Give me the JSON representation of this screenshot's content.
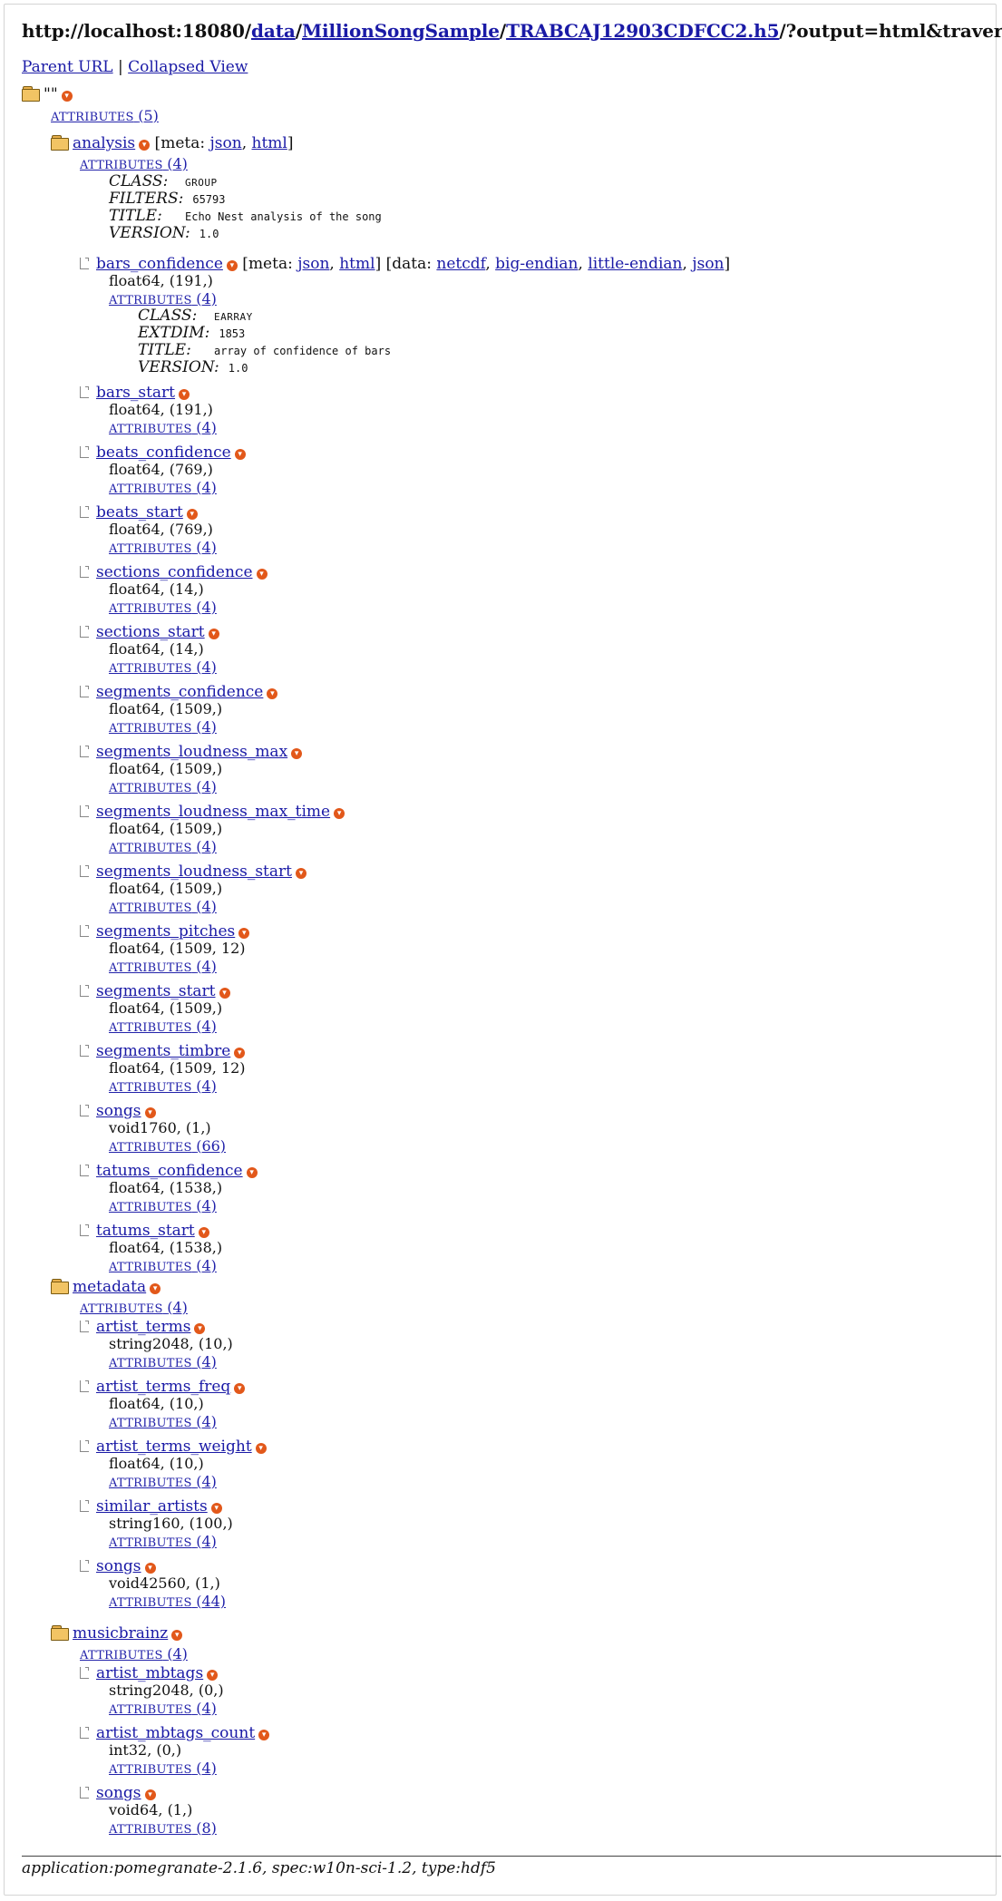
{
  "url": {
    "prefix": "http://localhost:18080/",
    "parts": [
      "data",
      "MillionSongSample",
      "TRABCAJ12903CDFCC2.h5"
    ],
    "suffix": "/?output=html&traverse"
  },
  "nav": {
    "parent": "Parent URL",
    "sep": "|",
    "collapsed": "Collapsed View"
  },
  "root": {
    "name": "\"\"",
    "attrs_label": "ATTRIBUTES",
    "attrs_count": "(5)"
  },
  "labels": {
    "meta": "meta",
    "data": "data",
    "attrs": "ATTRIBUTES",
    "expand_glyph": "▾"
  },
  "meta_links": [
    "json",
    "html"
  ],
  "data_links": [
    "netcdf",
    "big-endian",
    "little-endian",
    "json"
  ],
  "groups": [
    {
      "name": "analysis",
      "attrs_count": "(4)",
      "attributes": [
        {
          "key": "CLASS:",
          "val": "GROUP",
          "sc": true
        },
        {
          "key": "FILTERS:",
          "val": "65793"
        },
        {
          "key": "TITLE:",
          "val": "Echo Nest analysis of the song"
        },
        {
          "key": "VERSION:",
          "val": "1.0"
        }
      ],
      "datasets": [
        {
          "name": "bars_confidence",
          "dtype": "float64, (191,)",
          "attrs_count": "(4)",
          "expanded": true,
          "attributes": [
            {
              "key": "CLASS:",
              "val": "EARRAY",
              "sc": true
            },
            {
              "key": "EXTDIM:",
              "val": "1853"
            },
            {
              "key": "TITLE:",
              "val": "array of confidence of bars"
            },
            {
              "key": "VERSION:",
              "val": "1.0"
            }
          ]
        },
        {
          "name": "bars_start",
          "dtype": "float64, (191,)",
          "attrs_count": "(4)"
        },
        {
          "name": "beats_confidence",
          "dtype": "float64, (769,)",
          "attrs_count": "(4)"
        },
        {
          "name": "beats_start",
          "dtype": "float64, (769,)",
          "attrs_count": "(4)"
        },
        {
          "name": "sections_confidence",
          "dtype": "float64, (14,)",
          "attrs_count": "(4)"
        },
        {
          "name": "sections_start",
          "dtype": "float64, (14,)",
          "attrs_count": "(4)"
        },
        {
          "name": "segments_confidence",
          "dtype": "float64, (1509,)",
          "attrs_count": "(4)"
        },
        {
          "name": "segments_loudness_max",
          "dtype": "float64, (1509,)",
          "attrs_count": "(4)"
        },
        {
          "name": "segments_loudness_max_time",
          "dtype": "float64, (1509,)",
          "attrs_count": "(4)"
        },
        {
          "name": "segments_loudness_start",
          "dtype": "float64, (1509,)",
          "attrs_count": "(4)"
        },
        {
          "name": "segments_pitches",
          "dtype": "float64, (1509, 12)",
          "attrs_count": "(4)"
        },
        {
          "name": "segments_start",
          "dtype": "float64, (1509,)",
          "attrs_count": "(4)"
        },
        {
          "name": "segments_timbre",
          "dtype": "float64, (1509, 12)",
          "attrs_count": "(4)"
        },
        {
          "name": "songs",
          "dtype": "void1760, (1,)",
          "attrs_count": "(66)"
        },
        {
          "name": "tatums_confidence",
          "dtype": "float64, (1538,)",
          "attrs_count": "(4)"
        },
        {
          "name": "tatums_start",
          "dtype": "float64, (1538,)",
          "attrs_count": "(4)"
        }
      ]
    },
    {
      "name": "metadata",
      "attrs_count": "(4)",
      "datasets": [
        {
          "name": "artist_terms",
          "dtype": "string2048, (10,)",
          "attrs_count": "(4)"
        },
        {
          "name": "artist_terms_freq",
          "dtype": "float64, (10,)",
          "attrs_count": "(4)"
        },
        {
          "name": "artist_terms_weight",
          "dtype": "float64, (10,)",
          "attrs_count": "(4)"
        },
        {
          "name": "similar_artists",
          "dtype": "string160, (100,)",
          "attrs_count": "(4)"
        },
        {
          "name": "songs",
          "dtype": "void42560, (1,)",
          "attrs_count": "(44)"
        }
      ]
    },
    {
      "name": "musicbrainz",
      "attrs_count": "(4)",
      "datasets": [
        {
          "name": "artist_mbtags",
          "dtype": "string2048, (0,)",
          "attrs_count": "(4)"
        },
        {
          "name": "artist_mbtags_count",
          "dtype": "int32, (0,)",
          "attrs_count": "(4)"
        },
        {
          "name": "songs",
          "dtype": "void64, (1,)",
          "attrs_count": "(8)"
        }
      ]
    }
  ],
  "footer": "application:pomegranate-2.1.6, spec:w10n-sci-1.2, type:hdf5"
}
